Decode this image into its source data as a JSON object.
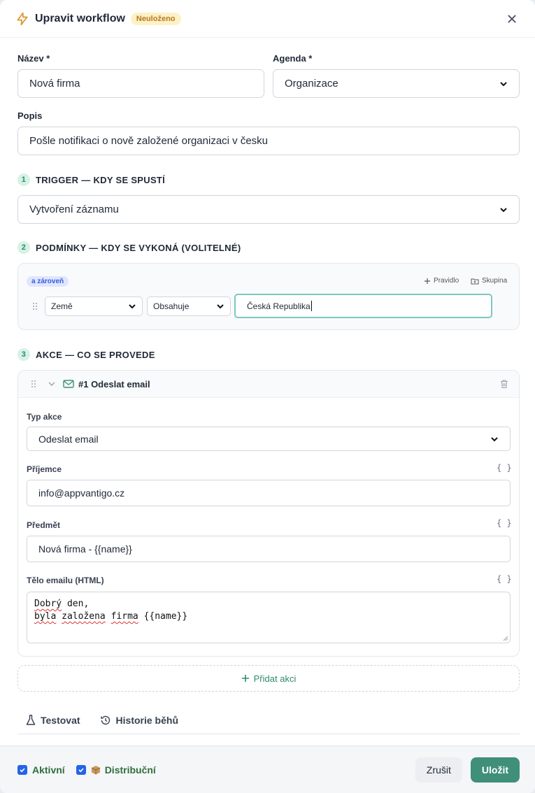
{
  "header": {
    "title": "Upravit workflow",
    "badge": "Neuloženo",
    "icon": "bolt-icon"
  },
  "form": {
    "name_label": "Název *",
    "name_value": "Nová firma",
    "agenda_label": "Agenda *",
    "agenda_value": "Organizace",
    "description_label": "Popis",
    "description_value": "Pošle notifikaci o nově založené organizaci v česku"
  },
  "trigger": {
    "step": "1",
    "title": "TRIGGER — KDY SE SPUSTÍ",
    "value": "Vytvoření záznamu"
  },
  "conditions": {
    "step": "2",
    "title": "PODMÍNKY — KDY SE VYKONÁ (VOLITELNÉ)",
    "group_operator": "a zároveň",
    "add_rule": "Pravidlo",
    "add_group": "Skupina",
    "rule": {
      "field": "Země",
      "operator": "Obsahuje",
      "value": "Česká Republika"
    }
  },
  "actions": {
    "step": "3",
    "title": "AKCE — CO SE PROVEDE",
    "card": {
      "title": "#1 Odeslat email",
      "type_label": "Typ akce",
      "type_value": "Odeslat email",
      "recipient_label": "Příjemce",
      "recipient_value": "info@appvantigo.cz",
      "subject_label": "Předmět",
      "subject_value": "Nová firma - {{name}}",
      "body_label": "Tělo emailu (HTML)",
      "body_line1_word1": "Dobrý",
      "body_line1_rest": " den,",
      "body_line2_word1": "byla",
      "body_line2_space1": " ",
      "body_line2_word2": "založena",
      "body_line2_space2": " ",
      "body_line2_word3": "firma",
      "body_line2_rest": " {{name}}",
      "variable_hint": "{ }"
    },
    "add_action": "Přidat akci"
  },
  "tabs": {
    "test": "Testovat",
    "history": "Historie běhů"
  },
  "footer": {
    "active_label": "Aktivní",
    "distribution_label": "Distribuční",
    "cancel": "Zrušit",
    "save": "Uložit"
  },
  "colors": {
    "accent": "#3f8f79",
    "badge_bg": "#fdf1c7",
    "badge_text": "#b7791f",
    "focus_border": "#7cc8be"
  }
}
